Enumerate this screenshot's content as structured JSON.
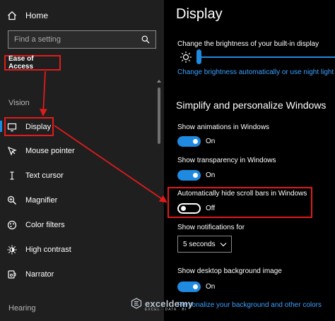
{
  "sidebar": {
    "home_label": "Home",
    "search_placeholder": "Find a setting",
    "category": "Ease of Access",
    "sections": {
      "vision": "Vision",
      "hearing": "Hearing"
    },
    "items": [
      {
        "label": "Display",
        "icon": "monitor-icon",
        "selected": true
      },
      {
        "label": "Mouse pointer",
        "icon": "mouse-pointer-icon"
      },
      {
        "label": "Text cursor",
        "icon": "text-cursor-icon"
      },
      {
        "label": "Magnifier",
        "icon": "magnifier-icon"
      },
      {
        "label": "Color filters",
        "icon": "color-filters-icon"
      },
      {
        "label": "High contrast",
        "icon": "high-contrast-icon"
      },
      {
        "label": "Narrator",
        "icon": "narrator-icon"
      }
    ]
  },
  "main": {
    "title": "Display",
    "brightness_label": "Change the brightness of your built-in display",
    "brightness_link": "Change brightness automatically or use night light",
    "section_heading": "Simplify and personalize Windows",
    "settings": {
      "animations": {
        "label": "Show animations in Windows",
        "state": "On"
      },
      "transparency": {
        "label": "Show transparency in Windows",
        "state": "On"
      },
      "scrollbars": {
        "label": "Automatically hide scroll bars in Windows",
        "state": "Off"
      },
      "notifications": {
        "label": "Show notifications for",
        "value": "5 seconds"
      },
      "background": {
        "label": "Show desktop background image",
        "state": "On"
      }
    },
    "bottom_link": "Personalize your background and other colors"
  },
  "watermark": {
    "name": "exceldemy",
    "tagline": "EXCEL · DATA · BI"
  },
  "colors": {
    "accent": "#1f8ae0",
    "highlight": "#e11b1b",
    "link": "#3aa0ff"
  }
}
